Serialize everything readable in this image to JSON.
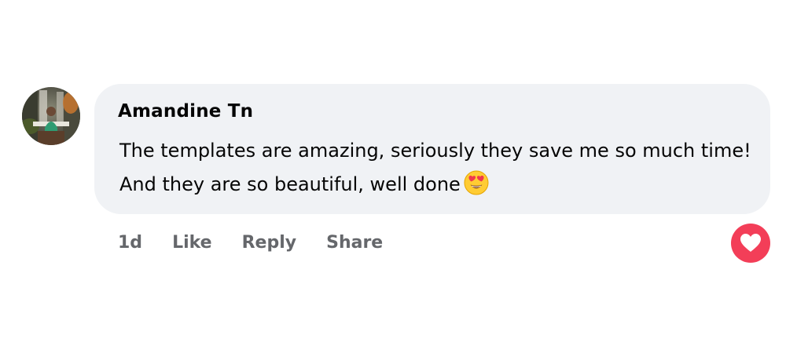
{
  "comment": {
    "author": "Amandine Tn",
    "text": "The templates are amazing, seriously they save me so much time! And they are so beautiful, well done",
    "emoji": "heart-eyes-emoji",
    "timestamp": "1d",
    "actions": {
      "like": "Like",
      "reply": "Reply",
      "share": "Share"
    },
    "reaction": "love",
    "colors": {
      "bubble": "#f0f2f5",
      "text": "#050505",
      "muted": "#65676b",
      "love_reaction": "#f33e58"
    }
  }
}
